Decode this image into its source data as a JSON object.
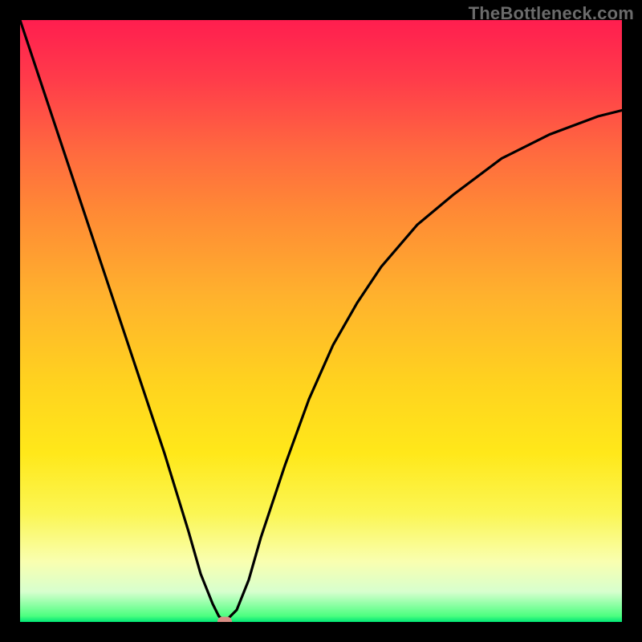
{
  "watermark": "TheBottleneck.com",
  "colors": {
    "frame": "#000000",
    "gradient_top": "#ff1e4f",
    "gradient_mid": "#ffd21f",
    "gradient_bottom": "#00e676",
    "curve": "#000000",
    "marker": "#d98e84"
  },
  "chart_data": {
    "type": "line",
    "title": "",
    "xlabel": "",
    "ylabel": "",
    "xlim": [
      0,
      100
    ],
    "ylim": [
      0,
      100
    ],
    "x": [
      0,
      4,
      8,
      12,
      16,
      20,
      24,
      28,
      30,
      32,
      33,
      34,
      36,
      38,
      40,
      44,
      48,
      52,
      56,
      60,
      66,
      72,
      80,
      88,
      96,
      100
    ],
    "values": [
      100,
      88,
      76,
      64,
      52,
      40,
      28,
      15,
      8,
      3,
      1,
      0,
      2,
      7,
      14,
      26,
      37,
      46,
      53,
      59,
      66,
      71,
      77,
      81,
      84,
      85
    ],
    "marker": {
      "x": 34,
      "y": 0
    },
    "grid": false,
    "legend": false
  }
}
